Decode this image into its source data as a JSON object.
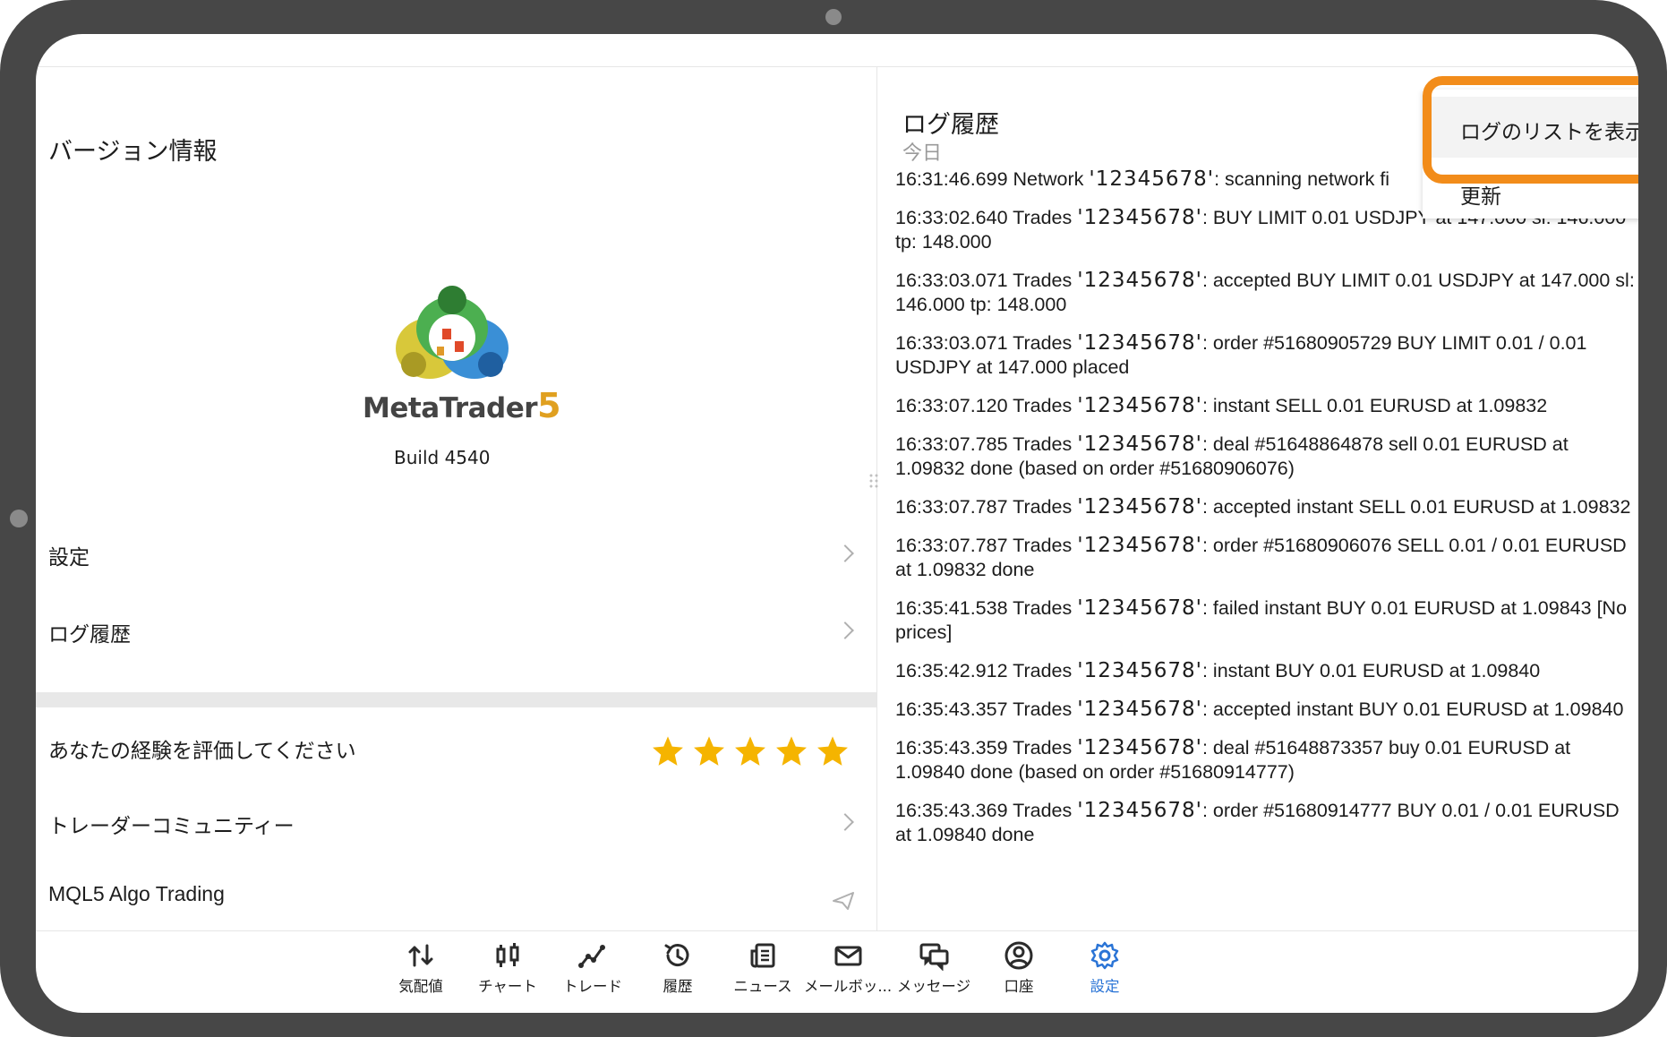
{
  "left_pane": {
    "version_title": "バージョン情報",
    "brand_name": "MetaTrader",
    "brand_number": "5",
    "build": "Build 4540",
    "settings_label": "設定",
    "log_history_label": "ログ履歴",
    "rate_label": "あなたの経験を評価してください",
    "rating_stars": 5,
    "community_label": "トレーダーコミュニティー",
    "mql5_label": "MQL5 Algo Trading"
  },
  "right_pane": {
    "title": "ログ履歴",
    "subtitle": "今日",
    "logs": [
      {
        "time": "16:31:46.699",
        "source": "Network",
        "account": "'12345678'",
        "message": ": scanning network fi"
      },
      {
        "time": "16:33:02.640",
        "source": "Trades",
        "account": "'12345678'",
        "message": ": BUY LIMIT 0.01 USDJPY at 147.000 sl: 146.000 tp: 148.000"
      },
      {
        "time": "16:33:03.071",
        "source": "Trades",
        "account": "'12345678'",
        "message": ": accepted BUY LIMIT 0.01 USDJPY at 147.000 sl: 146.000 tp: 148.000"
      },
      {
        "time": "16:33:03.071",
        "source": "Trades",
        "account": "'12345678'",
        "message": ": order #51680905729 BUY LIMIT 0.01 / 0.01 USDJPY at 147.000 placed"
      },
      {
        "time": "16:33:07.120",
        "source": "Trades",
        "account": "'12345678'",
        "message": ": instant SELL 0.01 EURUSD at 1.09832"
      },
      {
        "time": "16:33:07.785",
        "source": "Trades",
        "account": "'12345678'",
        "message": ": deal #51648864878 sell 0.01 EURUSD at 1.09832 done (based on order #51680906076)"
      },
      {
        "time": "16:33:07.787",
        "source": "Trades",
        "account": "'12345678'",
        "message": ": accepted instant SELL 0.01 EURUSD at 1.09832"
      },
      {
        "time": "16:33:07.787",
        "source": "Trades",
        "account": "'12345678'",
        "message": ": order #51680906076 SELL 0.01 / 0.01 EURUSD at 1.09832 done"
      },
      {
        "time": "16:35:41.538",
        "source": "Trades",
        "account": "'12345678'",
        "message": ": failed instant BUY 0.01 EURUSD at 1.09843 [No prices]"
      },
      {
        "time": "16:35:42.912",
        "source": "Trades",
        "account": "'12345678'",
        "message": ": instant BUY 0.01 EURUSD at 1.09840"
      },
      {
        "time": "16:35:43.357",
        "source": "Trades",
        "account": "'12345678'",
        "message": ": accepted instant BUY 0.01 EURUSD at 1.09840"
      },
      {
        "time": "16:35:43.359",
        "source": "Trades",
        "account": "'12345678'",
        "message": ": deal #51648873357 buy 0.01 EURUSD at 1.09840 done (based on order #51680914777)"
      },
      {
        "time": "16:35:43.369",
        "source": "Trades",
        "account": "'12345678'",
        "message": ": order #51680914777 BUY 0.01 / 0.01 EURUSD at 1.09840 done"
      }
    ]
  },
  "menu": {
    "show_log_list": "ログのリストを表示",
    "refresh": "更新"
  },
  "bottom_nav": {
    "items": [
      {
        "label": "気配値",
        "icon": "quotes-icon"
      },
      {
        "label": "チャート",
        "icon": "chart-icon"
      },
      {
        "label": "トレード",
        "icon": "trade-icon"
      },
      {
        "label": "履歴",
        "icon": "history-icon"
      },
      {
        "label": "ニュース",
        "icon": "news-icon"
      },
      {
        "label": "メールボッ...",
        "icon": "mailbox-icon"
      },
      {
        "label": "メッセージ",
        "icon": "messages-icon"
      },
      {
        "label": "口座",
        "icon": "account-icon"
      },
      {
        "label": "設定",
        "icon": "settings-icon"
      }
    ],
    "active_index": 8
  },
  "colors": {
    "accent": "#2a74d6",
    "star": "#f5b400",
    "highlight_border": "#f28c1a",
    "bezel": "#474747"
  }
}
